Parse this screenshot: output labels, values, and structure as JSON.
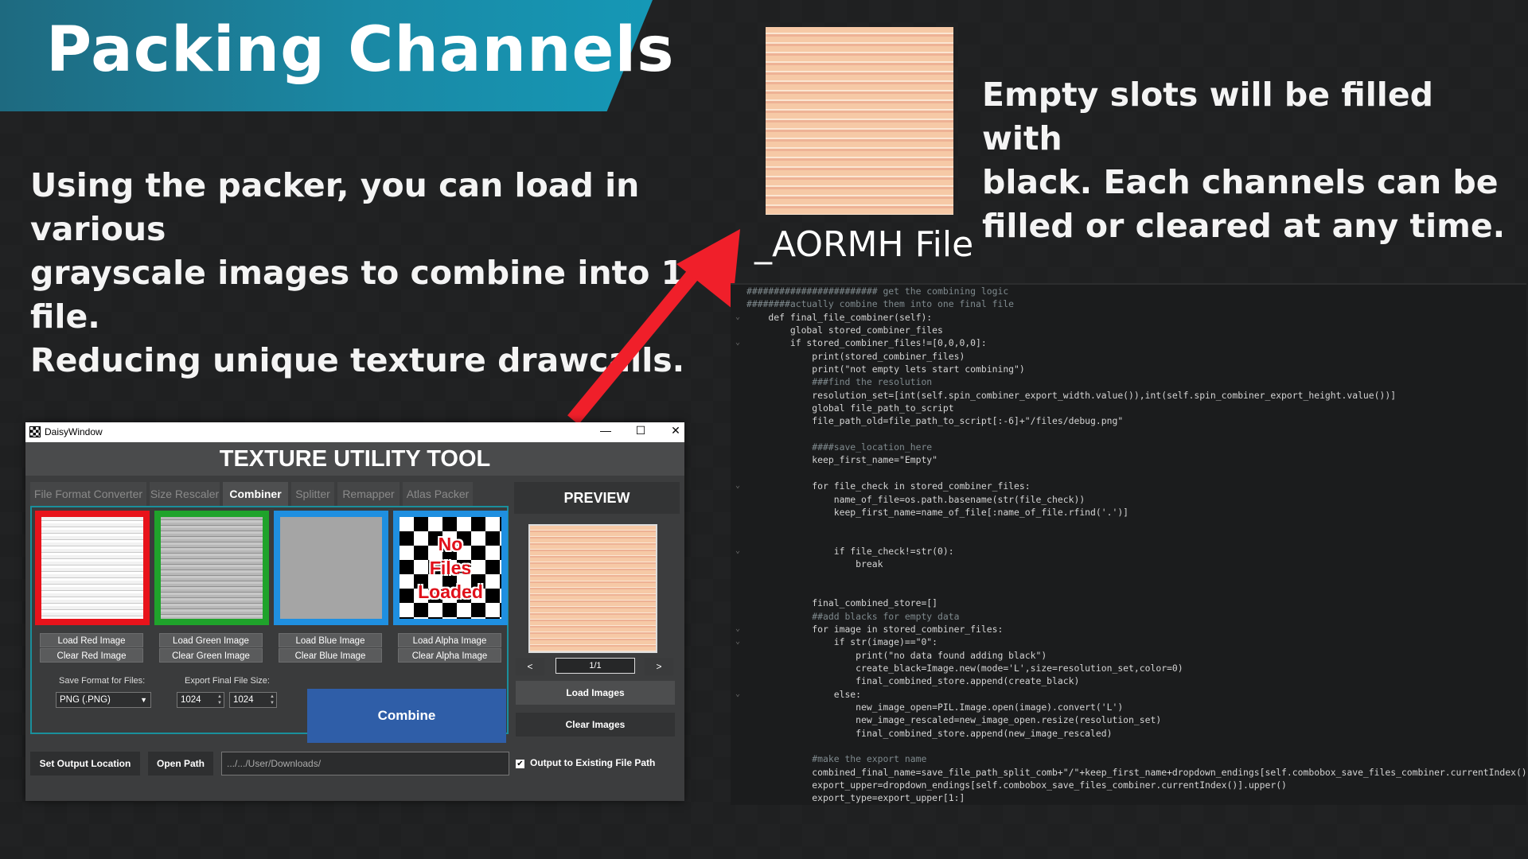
{
  "slide": {
    "title": "Packing Channels",
    "intro": "Using the packer, you can load in various\ngrayscale images to combine into 1 file.\nReducing unique texture drawcalls.",
    "side_text": "Empty slots will be filled with\nblack. Each channels can be\nfilled or cleared at any time.",
    "aormh_label": "_AORMH File"
  },
  "window": {
    "title": "DaisyWindow",
    "minimize": "—",
    "maximize": "☐",
    "close": "✕",
    "app_title": "TEXTURE UTILITY TOOL",
    "tabs": [
      "File Format Converter",
      "Size Rescaler",
      "Combiner",
      "Splitter",
      "Remapper",
      "Atlas Packer"
    ],
    "active_tab": "Combiner",
    "no_files": [
      "No",
      "Files",
      "Loaded"
    ],
    "slot_colors": {
      "red": "#e8131b",
      "green": "#1fa32b",
      "blue": "#1f8fe0"
    },
    "load_buttons": [
      "Load Red Image",
      "Load Green Image",
      "Load Blue Image",
      "Load Alpha Image"
    ],
    "clear_buttons": [
      "Clear Red Image",
      "Clear Green Image",
      "Clear Blue Image",
      "Clear Alpha Image"
    ],
    "save_format_label": "Save Format for Files:",
    "save_format_value": "PNG (.PNG)",
    "export_size_label": "Export Final File Size:",
    "export_width": "1024",
    "export_height": "1024",
    "combine": "Combine",
    "preview_title": "PREVIEW",
    "prev": "<",
    "next": ">",
    "page": "1/1",
    "load_images": "Load Images",
    "clear_images": "Clear Images",
    "set_output": "Set Output Location",
    "open_path": "Open Path",
    "path_value": ".../.../User/Downloads/",
    "output_existing": "Output to Existing File Path",
    "output_existing_checked": true
  },
  "code_lines": [
    "######################## get the combining logic",
    "########actually combine them into one final file",
    "    def final_file_combiner(self):",
    "        global stored_combiner_files",
    "        if stored_combiner_files!=[0,0,0,0]:",
    "            print(stored_combiner_files)",
    "            print(\"not empty lets start combining\")",
    "            ###find the resolution",
    "            resolution_set=[int(self.spin_combiner_export_width.value()),int(self.spin_combiner_export_height.value())]",
    "            global file_path_to_script",
    "            file_path_old=file_path_to_script[:-6]+\"/files/debug.png\"",
    "",
    "            ####save_location_here",
    "            keep_first_name=\"Empty\"",
    "",
    "            for file_check in stored_combiner_files:",
    "                name_of_file=os.path.basename(str(file_check))",
    "                keep_first_name=name_of_file[:name_of_file.rfind('.')]",
    "",
    "",
    "                if file_check!=str(0):",
    "                    break",
    "",
    "",
    "            final_combined_store=[]",
    "            ##add blacks for empty data",
    "            for image in stored_combiner_files:",
    "                if str(image)==\"0\":",
    "                    print(\"no data found adding black\")",
    "                    create_black=Image.new(mode='L',size=resolution_set,color=0)",
    "                    final_combined_store.append(create_black)",
    "                else:",
    "                    new_image_open=PIL.Image.open(image).convert('L')",
    "                    new_image_rescaled=new_image_open.resize(resolution_set)",
    "                    final_combined_store.append(new_image_rescaled)",
    "",
    "            #make the export name",
    "            combined_final_name=save_file_path_split_comb+\"/\"+keep_first_name+dropdown_endings[self.combobox_save_files_combiner.currentIndex()]",
    "            export_upper=dropdown_endings[self.combobox_save_files_combiner.currentIndex()].upper()",
    "            export_type=export_upper[1:]"
  ]
}
